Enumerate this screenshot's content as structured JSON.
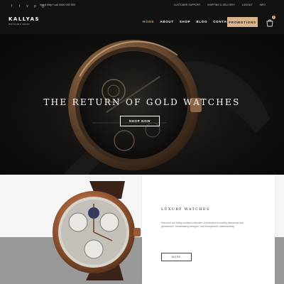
{
  "header": {
    "social_icons": [
      "facebook-icon",
      "twitter-icon",
      "vimeo-icon",
      "pinterest-icon",
      "instagram-icon"
    ],
    "help_text": "Need Help? call 0000 000 000",
    "top_links": [
      "CUSTOMER SUPPORT",
      "SHIPPING & DELIVERY",
      "LOGOUT",
      "INFO"
    ],
    "logo": "KALLYAS",
    "tagline": "WATCHES SHOP",
    "nav": [
      "HOME",
      "ABOUT",
      "SHOP",
      "BLOG",
      "CONTACT"
    ],
    "promo_label": "PROMOTIONS",
    "cart_count": "1"
  },
  "hero": {
    "title": "THE RETURN OF GOLD WATCHES",
    "button": "SHOP NOW"
  },
  "feature": {
    "title": "LUXURY WATCHES",
    "text": "Discover our finely curated collection of investment-worthy diamonds and gemstones, breathtaking designs, and exceptional craftsmanship.",
    "button": "MORE"
  },
  "colors": {
    "accent": "#d9b48c",
    "dark": "#121212",
    "hero_bg": "#0b0b0b"
  }
}
